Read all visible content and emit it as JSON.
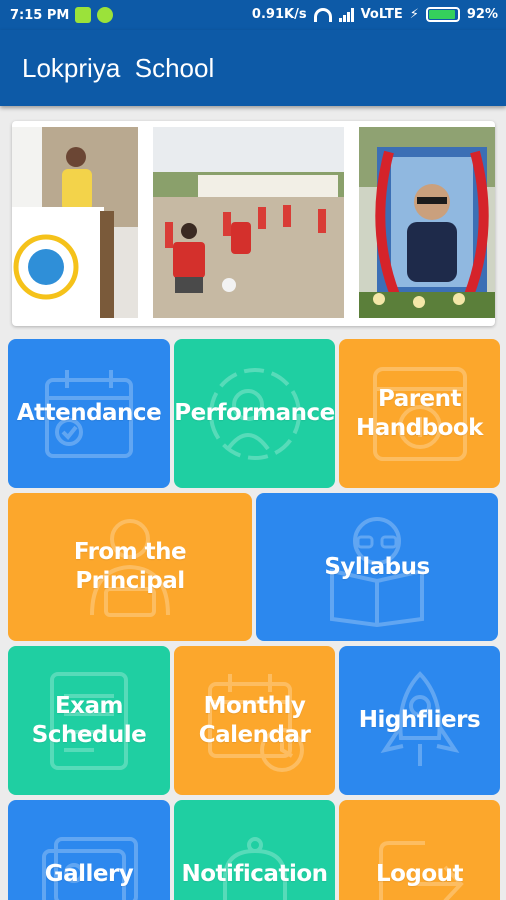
{
  "status_bar": {
    "time": "7:15 PM",
    "network_speed": "0.91K/s",
    "network_type": "VoLTE",
    "battery": "92%",
    "battery_level": 0.92
  },
  "app_bar": {
    "title": "Lokpriya  School"
  },
  "colors": {
    "primary": "#0d5aa7",
    "tile_blue": "#2c88ee",
    "tile_green": "#1fcfa2",
    "tile_orange": "#fca72c"
  },
  "tiles": [
    {
      "label": "Attendance",
      "icon": "calendar-check-icon",
      "color": "blue"
    },
    {
      "label": "Performance",
      "icon": "chart-gauge-icon",
      "color": "green"
    },
    {
      "label": "Parent\nHandbook",
      "icon": "handbook-icon",
      "color": "orange"
    },
    {
      "label": "From the\nPrincipal",
      "icon": "principal-icon",
      "color": "orange"
    },
    {
      "label": "Syllabus",
      "icon": "reading-person-icon",
      "color": "blue"
    },
    {
      "label": "Exam\nSchedule",
      "icon": "exam-sheet-icon",
      "color": "green"
    },
    {
      "label": "Monthly\nCalendar",
      "icon": "calendar-clock-icon",
      "color": "orange"
    },
    {
      "label": "Highfliers",
      "icon": "rocket-icon",
      "color": "blue"
    },
    {
      "label": "Gallery",
      "icon": "gallery-icon",
      "color": "blue"
    },
    {
      "label": "Notification",
      "icon": "bell-icon",
      "color": "green"
    },
    {
      "label": "Logout",
      "icon": "logout-icon",
      "color": "orange"
    }
  ]
}
